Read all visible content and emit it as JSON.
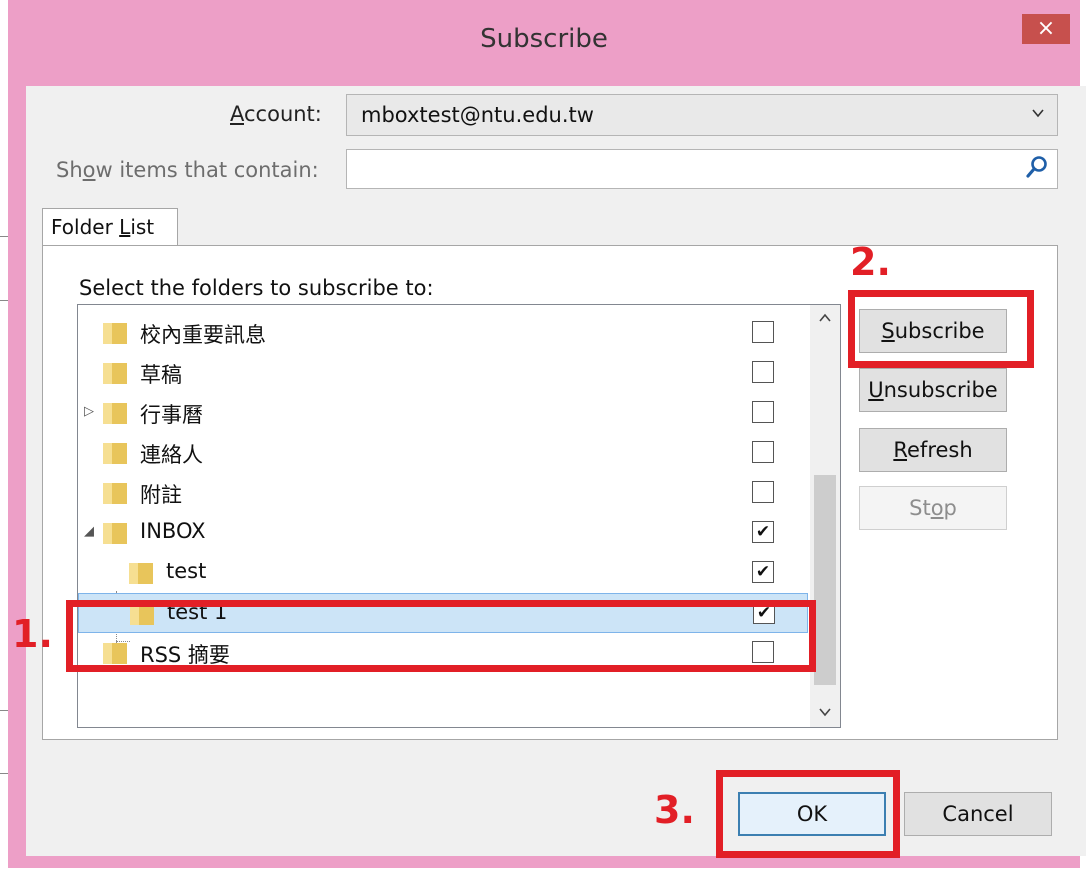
{
  "window": {
    "title": "Subscribe",
    "close_glyph": "×"
  },
  "account": {
    "label_prefix": "",
    "label_key": "A",
    "label_rest": "ccount:",
    "value": "mboxtest@ntu.edu.tw"
  },
  "filter": {
    "label_pre": "Sh",
    "label_key": "o",
    "label_rest": "w items that contain:",
    "value": ""
  },
  "tab": {
    "label_pre": "Folder ",
    "label_key": "L",
    "label_rest": "ist"
  },
  "panel": {
    "instruction": "Select the folders to subscribe to:"
  },
  "folders": [
    {
      "name": "校內重要訊息",
      "checked": false
    },
    {
      "name": "草稿",
      "checked": false
    },
    {
      "name": "行事曆",
      "checked": false,
      "expander": "▷"
    },
    {
      "name": "連絡人",
      "checked": false
    },
    {
      "name": "附註",
      "checked": false
    },
    {
      "name": "INBOX",
      "checked": true,
      "expander": "◢"
    },
    {
      "name": "test",
      "checked": true
    },
    {
      "name": "test 1",
      "checked": true,
      "selected": true
    },
    {
      "name": "RSS 摘要",
      "checked": false
    }
  ],
  "check_glyph": "✔",
  "buttons": {
    "subscribe": {
      "key": "S",
      "rest": "ubscribe"
    },
    "unsubscribe": {
      "key": "U",
      "rest": "nsubscribe"
    },
    "refresh": {
      "key": "R",
      "rest": "efresh"
    },
    "stop": {
      "pre": "St",
      "key": "o",
      "rest": "p"
    },
    "ok": "OK",
    "cancel": "Cancel"
  },
  "steps": [
    "1.",
    "2.",
    "3."
  ],
  "colors": {
    "frame": "#ed9fc7",
    "highlight": "#e21f26",
    "selection": "#cce4f7"
  },
  "icons": {
    "close": "close-icon",
    "dropdown": "chevron-down-icon",
    "search": "search-icon",
    "folder": "folder-icon"
  }
}
